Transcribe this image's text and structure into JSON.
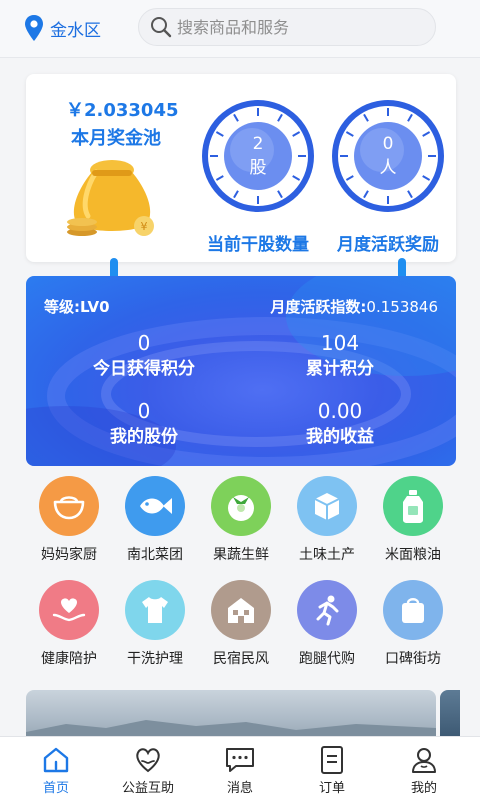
{
  "header": {
    "location": "金水区",
    "search_placeholder": "搜索商品和服务"
  },
  "stats": {
    "pool_amount": "￥2.033045",
    "pool_label": "本月奖金池",
    "shares_value": "2",
    "shares_unit": "股",
    "shares_caption": "当前干股数量",
    "active_value": "0",
    "active_unit": "人",
    "active_caption": "月度活跃奖励"
  },
  "panel": {
    "level": "等级:LV0",
    "active_index_label": "月度活跃指数:",
    "active_index_value": "0.153846",
    "today_points": "0",
    "today_points_label": "今日获得积分",
    "total_points": "104",
    "total_points_label": "累计积分",
    "my_shares": "0",
    "my_shares_label": "我的股份",
    "my_income": "0.00",
    "my_income_label": "我的收益"
  },
  "grid": [
    {
      "label": "妈妈家厨",
      "icon": "bowl-icon",
      "color": "#f59a45"
    },
    {
      "label": "南北菜团",
      "icon": "fish-icon",
      "color": "#3f9bee"
    },
    {
      "label": "果蔬生鲜",
      "icon": "tomato-icon",
      "color": "#7ed15a"
    },
    {
      "label": "土味土产",
      "icon": "box-icon",
      "color": "#7ec2f2"
    },
    {
      "label": "米面粮油",
      "icon": "oil-bottle-icon",
      "color": "#4fd38a"
    },
    {
      "label": "健康陪护",
      "icon": "heart-hand-icon",
      "color": "#f07b86"
    },
    {
      "label": "干洗护理",
      "icon": "shirt-icon",
      "color": "#7fd6ec"
    },
    {
      "label": "民宿民风",
      "icon": "house-icon",
      "color": "#b09b8d"
    },
    {
      "label": "跑腿代购",
      "icon": "runner-icon",
      "color": "#7d8be8"
    },
    {
      "label": "口碑街坊",
      "icon": "bag-icon",
      "color": "#7fb4ec"
    }
  ],
  "tabs": [
    {
      "label": "首页",
      "icon": "home-icon"
    },
    {
      "label": "公益互助",
      "icon": "charity-heart-icon"
    },
    {
      "label": "消息",
      "icon": "message-icon"
    },
    {
      "label": "订单",
      "icon": "order-icon"
    },
    {
      "label": "我的",
      "icon": "user-icon"
    }
  ],
  "colors": {
    "accent": "#1d78e6",
    "panel": "#3b5de8"
  }
}
